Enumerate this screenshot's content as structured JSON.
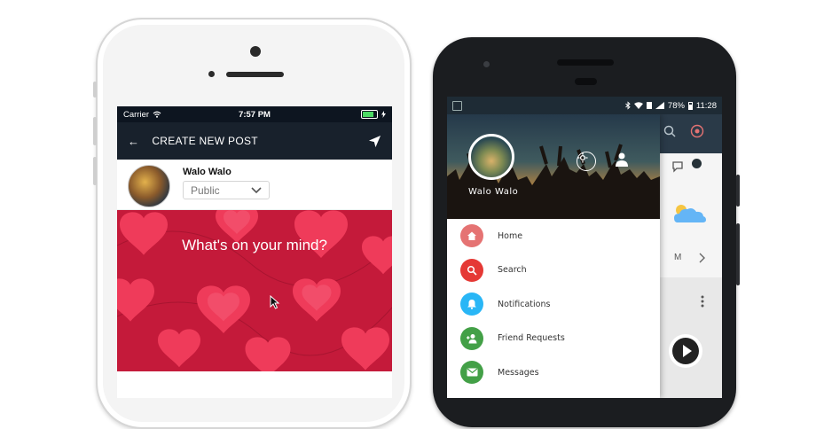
{
  "iphone": {
    "status": {
      "carrier": "Carrier",
      "time": "7:57 PM"
    },
    "nav": {
      "back_icon": "arrow-left-icon",
      "title": "CREATE NEW POST",
      "send_icon": "send-icon"
    },
    "composer": {
      "user_name": "Walo Walo",
      "privacy_value": "Public",
      "prompt": "What's on your mind?",
      "background_color": "#c41a3a"
    }
  },
  "android": {
    "status": {
      "battery": "78%",
      "time": "11:28"
    },
    "drawer": {
      "user_name": "Walo Walo",
      "items": [
        {
          "label": "Home",
          "icon": "home-icon",
          "color": "#e57373"
        },
        {
          "label": "Search",
          "icon": "search-icon",
          "color": "#e53935"
        },
        {
          "label": "Notifications",
          "icon": "bell-icon",
          "color": "#29b6f6"
        },
        {
          "label": "Friend Requests",
          "icon": "add-friend-icon",
          "color": "#43a047"
        },
        {
          "label": "Messages",
          "icon": "mail-icon",
          "color": "#43a047"
        }
      ]
    },
    "background_app": {
      "row_letter": "M"
    }
  },
  "colors": {
    "ios_bar": "#18212c",
    "android_status": "#1e2b35"
  }
}
